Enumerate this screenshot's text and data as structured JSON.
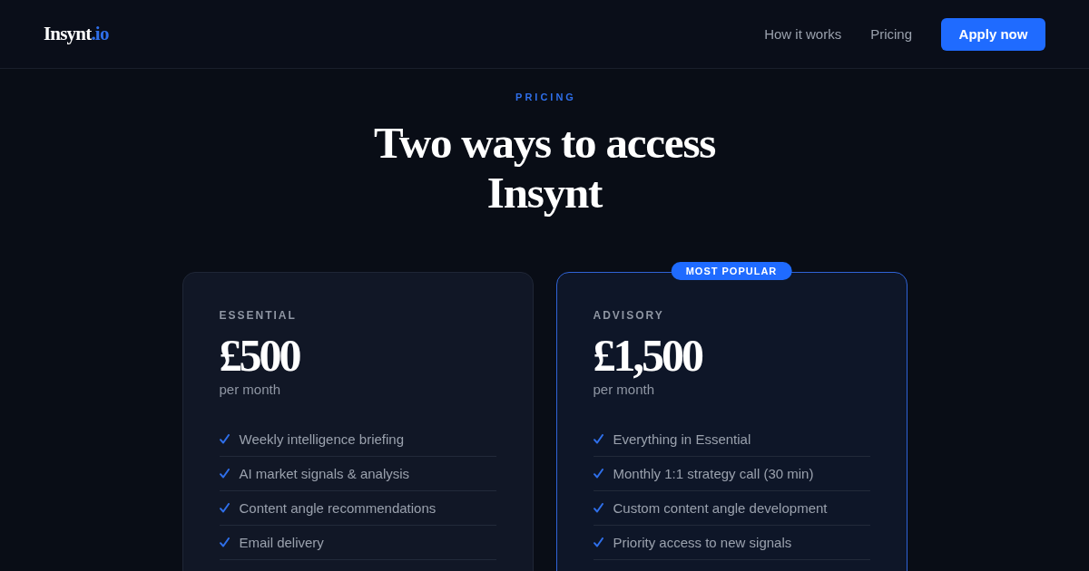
{
  "header": {
    "logo": {
      "name": "Insynt",
      "suffix": ".io"
    },
    "nav": [
      {
        "label": "How it works"
      },
      {
        "label": "Pricing"
      }
    ],
    "cta": "Apply now"
  },
  "section": {
    "eyebrow": "PRICING",
    "title": "Two ways to access Insynt"
  },
  "plans": [
    {
      "name": "ESSENTIAL",
      "price": "£500",
      "period": "per month",
      "featured": false,
      "features": [
        "Weekly intelligence briefing",
        "AI market signals & analysis",
        "Content angle recommendations",
        "Email delivery"
      ]
    },
    {
      "name": "ADVISORY",
      "badge": "MOST POPULAR",
      "price": "£1,500",
      "period": "per month",
      "featured": true,
      "features": [
        "Everything in Essential",
        "Monthly 1:1 strategy call (30 min)",
        "Custom content angle development",
        "Priority access to new signals"
      ]
    }
  ]
}
